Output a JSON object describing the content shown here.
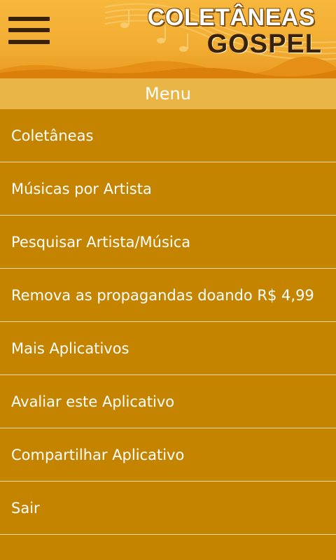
{
  "header": {
    "logo_line1": "COLETÂNEAS",
    "logo_line2": "GOSPEL"
  },
  "menu": {
    "title": "Menu",
    "items": [
      {
        "label": "Coletâneas"
      },
      {
        "label": "Músicas por Artista"
      },
      {
        "label": "Pesquisar Artista/Música"
      },
      {
        "label": "Remova as propagandas doando R$ 4,99"
      },
      {
        "label": "Mais Aplicativos"
      },
      {
        "label": "Avaliar este Aplicativo"
      },
      {
        "label": "Compartilhar Aplicativo"
      },
      {
        "label": "Sair"
      }
    ]
  },
  "colors": {
    "header_orange": "#f2ad32",
    "menu_bar": "#e9b547",
    "menu_background": "#c48400",
    "divider": "#f2dca5",
    "dark_brown": "#3a2208"
  }
}
